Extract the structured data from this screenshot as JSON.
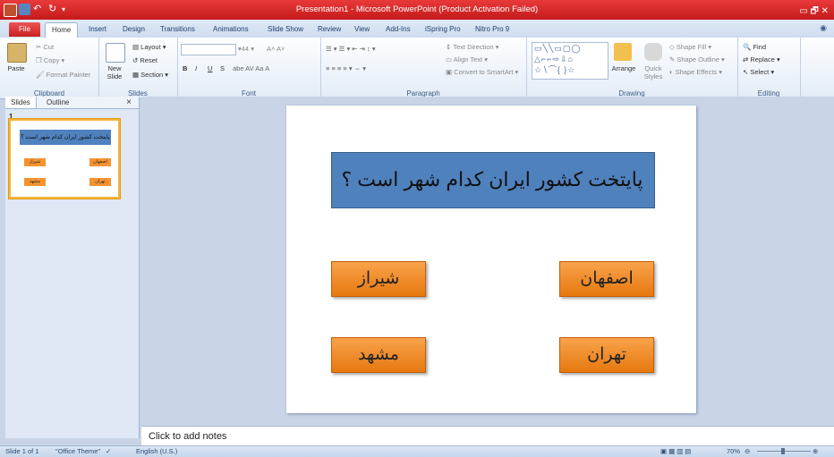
{
  "window": {
    "title": "Presentation1  -  Microsoft PowerPoint (Product Activation Failed)",
    "controls": "▭  🗗  ✕"
  },
  "tabs": [
    "File",
    "Home",
    "Insert",
    "Design",
    "Transitions",
    "Animations",
    "Slide Show",
    "Review",
    "View",
    "Add-Ins",
    "iSpring Pro",
    "Nitro Pro 9"
  ],
  "ribbon": {
    "clipboard": {
      "paste": "Paste",
      "cut": "Cut",
      "copy": "Copy",
      "format_painter": "Format Painter",
      "label": "Clipboard"
    },
    "slides": {
      "new_slide": "New Slide",
      "layout": "Layout",
      "reset": "Reset",
      "section": "Section",
      "label": "Slides"
    },
    "font": {
      "size": "44",
      "bold": "B",
      "italic": "I",
      "underline": "U",
      "strike": "S",
      "label": "Font"
    },
    "paragraph": {
      "text_direction": "Text Direction",
      "align_text": "Align Text",
      "smartart": "Convert to SmartArt",
      "label": "Paragraph"
    },
    "drawing": {
      "arrange": "Arrange",
      "quick_styles": "Quick Styles",
      "shape_fill": "Shape Fill",
      "shape_outline": "Shape Outline",
      "shape_effects": "Shape Effects",
      "label": "Drawing"
    },
    "editing": {
      "find": "Find",
      "replace": "Replace",
      "select": "Select",
      "label": "Editing"
    }
  },
  "left_pane": {
    "tab_slides": "Slides",
    "tab_outline": "Outline",
    "close": "×",
    "slide_number": "1"
  },
  "slide": {
    "question": "پایتخت کشور ایران کدام شهر است ؟",
    "answers": [
      "اصفهان",
      "شیراز",
      "تهران",
      "مشهد"
    ]
  },
  "notes": {
    "placeholder": "Click to add notes"
  },
  "status": {
    "slide_info": "Slide 1 of 1",
    "theme": "\"Office Theme\"",
    "language": "English (U.S.)",
    "zoom": "70%"
  },
  "colors": {
    "title_bar": "#d42020",
    "question_box": "#4f81bd",
    "answer_box": "#f59331",
    "slide_bg": "#ffffff"
  }
}
